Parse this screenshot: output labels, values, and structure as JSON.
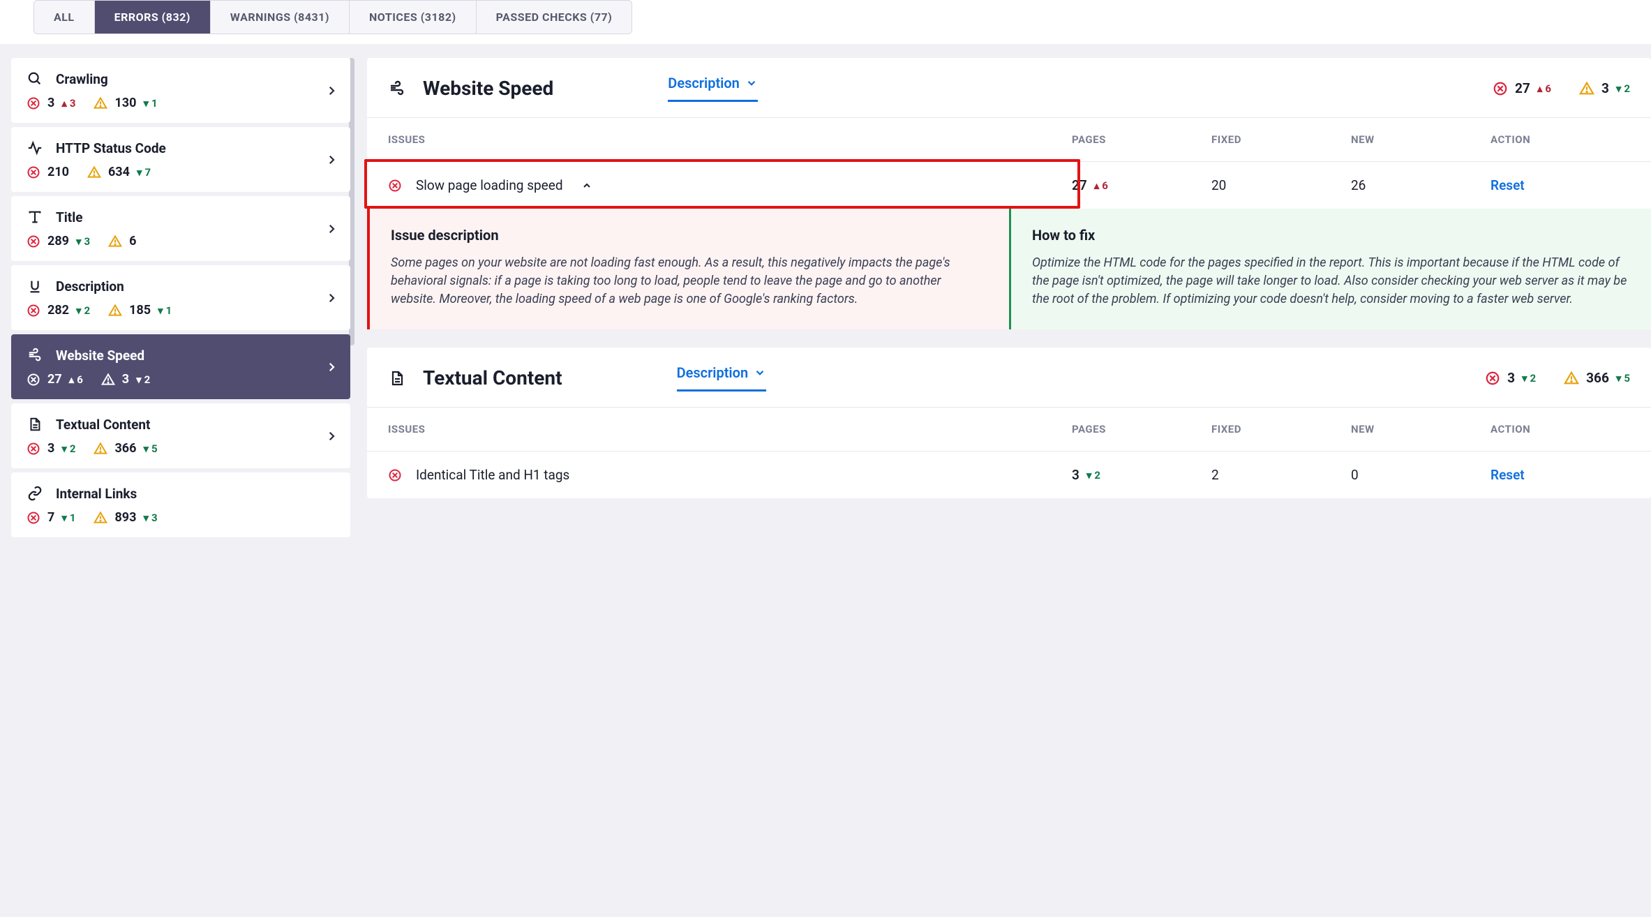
{
  "tabs": {
    "all": "ALL",
    "errors": "ERRORS (832)",
    "warnings": "WARNINGS (8431)",
    "notices": "NOTICES (3182)",
    "passed": "PASSED CHECKS (77)"
  },
  "sidebar": [
    {
      "title": "Crawling",
      "err": "3",
      "err_trend": "3",
      "err_dir": "up",
      "warn": "130",
      "warn_trend": "1",
      "warn_dir": "down"
    },
    {
      "title": "HTTP Status Code",
      "err": "210",
      "err_trend": "",
      "err_dir": "none",
      "warn": "634",
      "warn_trend": "7",
      "warn_dir": "down"
    },
    {
      "title": "Title",
      "err": "289",
      "err_trend": "3",
      "err_dir": "down",
      "warn": "6",
      "warn_trend": "",
      "warn_dir": "none"
    },
    {
      "title": "Description",
      "err": "282",
      "err_trend": "2",
      "err_dir": "down",
      "warn": "185",
      "warn_trend": "1",
      "warn_dir": "down"
    },
    {
      "title": "Website Speed",
      "err": "27",
      "err_trend": "6",
      "err_dir": "up",
      "warn": "3",
      "warn_trend": "2",
      "warn_dir": "down"
    },
    {
      "title": "Textual Content",
      "err": "3",
      "err_trend": "2",
      "err_dir": "down",
      "warn": "366",
      "warn_trend": "5",
      "warn_dir": "down"
    },
    {
      "title": "Internal Links",
      "err": "7",
      "err_trend": "1",
      "err_dir": "down",
      "warn": "893",
      "warn_trend": "3",
      "warn_dir": "down"
    }
  ],
  "sections": {
    "speed": {
      "title": "Website Speed",
      "tab_label": "Description",
      "err": "27",
      "err_trend": "6",
      "warn": "3",
      "warn_trend": "2",
      "head": {
        "issues": "ISSUES",
        "pages": "PAGES",
        "fixed": "FIXED",
        "new": "NEW",
        "action": "ACTION"
      },
      "row": {
        "issue": "Slow page loading speed",
        "pages": "27",
        "pages_trend": "6",
        "fixed": "20",
        "new": "26",
        "action": "Reset"
      },
      "desc_title": "Issue description",
      "desc_text": "Some pages on your website are not loading fast enough. As a result, this negatively impacts the page's behavioral signals: if a page is taking too long to load, people tend to leave the page and go to another website. Moreover, the loading speed of a web page is one of Google's ranking factors.",
      "fix_title": "How to fix",
      "fix_text": "Optimize the HTML code for the pages specified in the report. This is important because if the HTML code of the page isn't optimized, the page will take longer to load. Also consider checking your web server as it may be the root of the problem. If optimizing your code doesn't help, consider moving to a faster web server."
    },
    "textual": {
      "title": "Textual Content",
      "tab_label": "Description",
      "err": "3",
      "err_trend": "2",
      "warn": "366",
      "warn_trend": "5",
      "head": {
        "issues": "ISSUES",
        "pages": "PAGES",
        "fixed": "FIXED",
        "new": "NEW",
        "action": "ACTION"
      },
      "row": {
        "issue": "Identical Title and H1 tags",
        "pages": "3",
        "pages_trend": "2",
        "fixed": "2",
        "new": "0",
        "action": "Reset"
      }
    }
  }
}
